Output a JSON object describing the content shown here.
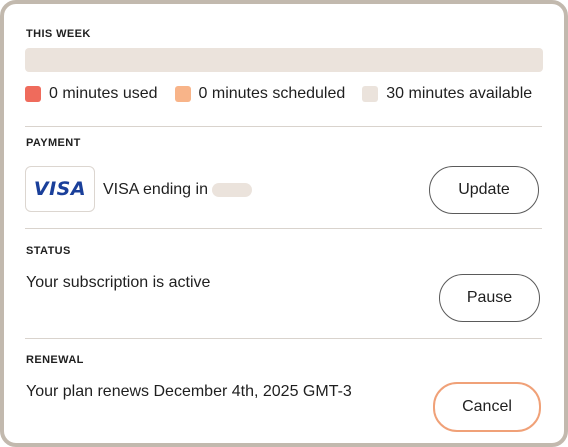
{
  "this_week": {
    "title": "THIS WEEK",
    "usage_fraction": 0,
    "legend": [
      {
        "label": "0 minutes used",
        "color": "#ef6b5c"
      },
      {
        "label": "0 minutes scheduled",
        "color": "#f8b489"
      },
      {
        "label": "30 minutes available",
        "color": "#ebe3dc"
      }
    ]
  },
  "payment": {
    "title": "PAYMENT",
    "card_brand": "VISA",
    "card_text": "VISA ending in",
    "update_label": "Update"
  },
  "status": {
    "title": "STATUS",
    "text": "Your subscription is active",
    "pause_label": "Pause"
  },
  "renewal": {
    "title": "RENEWAL",
    "text": "Your plan renews December 4th, 2025 GMT-3",
    "cancel_label": "Cancel"
  },
  "colors": {
    "border": "#c2b9ae",
    "cancel_border": "#f0a178",
    "visa_blue": "#1a3f9a"
  }
}
